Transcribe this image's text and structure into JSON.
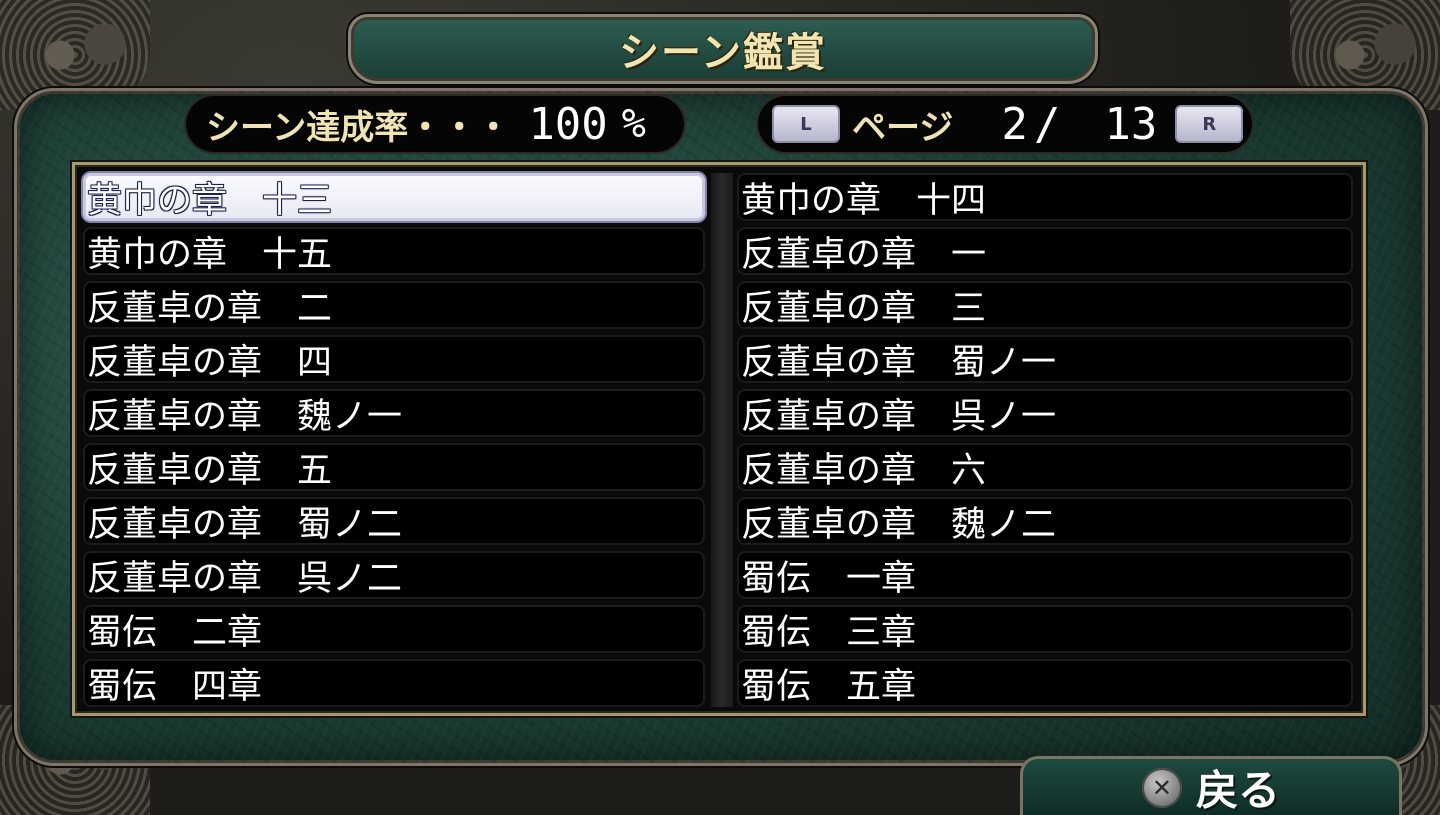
{
  "title": "シーン鑑賞",
  "completion": {
    "label": "シーン達成率・・・",
    "value": "100",
    "unit": "%"
  },
  "pager": {
    "left_button": "L",
    "label": "ページ",
    "current": "2",
    "separator": "/",
    "total": "13",
    "right_button": "R"
  },
  "scenes": {
    "left": [
      "黄巾の章　十三",
      "黄巾の章　十五",
      "反董卓の章　二",
      "反董卓の章　四",
      "反董卓の章　魏ノ一",
      "反董卓の章　五",
      "反董卓の章　蜀ノ二",
      "反董卓の章　呉ノ二",
      "蜀伝　二章",
      "蜀伝　四章"
    ],
    "right": [
      "黄巾の章　十四",
      "反董卓の章　一",
      "反董卓の章　三",
      "反董卓の章　蜀ノ一",
      "反董卓の章　呉ノ一",
      "反董卓の章　六",
      "反董卓の章　魏ノ二",
      "蜀伝　一章",
      "蜀伝　三章",
      "蜀伝　五章"
    ],
    "selected": "left-0"
  },
  "back": {
    "icon": "cross-button-icon",
    "label": "戻る"
  },
  "colors": {
    "panel_green": "#1c3c34",
    "title_gold": "#f2e6b0",
    "frame_gold": "#a59a6f"
  }
}
